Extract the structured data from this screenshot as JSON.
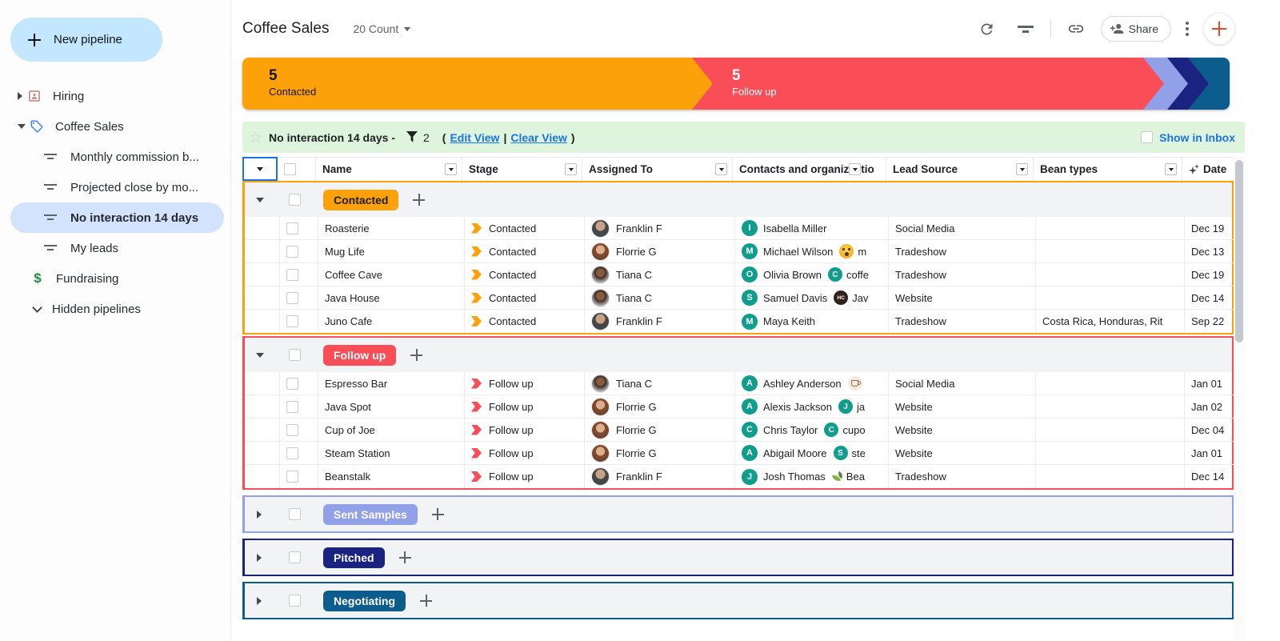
{
  "sidebar": {
    "new_pipeline_label": "New pipeline",
    "pipelines": [
      {
        "label": "Hiring"
      },
      {
        "label": "Coffee Sales"
      },
      {
        "label": "Fundraising"
      },
      {
        "label": "Hidden pipelines"
      }
    ],
    "views": [
      {
        "label": "Monthly commission b..."
      },
      {
        "label": "Projected close by mo..."
      },
      {
        "label": "No interaction 14 days"
      },
      {
        "label": "My leads"
      }
    ]
  },
  "header": {
    "title": "Coffee Sales",
    "count_label": "20 Count",
    "share_label": "Share"
  },
  "colors": {
    "contacted": "#FCA10A",
    "follow_up": "#F94D57",
    "sent_samples": "#92A0E8",
    "pitched": "#1A2480",
    "negotiating": "#0D5C8E",
    "link_blue": "#1A73E8",
    "filter_bar_green": "#DFF4DC",
    "contact_teal": "#0F9D8C",
    "accent_red_plus": "#E8442E"
  },
  "stagebar": {
    "stages": [
      {
        "name": "Contacted",
        "count": "5"
      },
      {
        "name": "Follow up",
        "count": "5"
      },
      {
        "name": "Sent Samples",
        "count": ""
      },
      {
        "name": "Pitched",
        "count": ""
      },
      {
        "name": "Negotiating",
        "count": ""
      }
    ]
  },
  "filterbar": {
    "view_name": "No interaction 14 days -",
    "filter_count": "2",
    "paren_open": "(",
    "edit_view": "Edit View",
    "pipe": "|",
    "clear_view": "Clear View",
    "paren_close": ")",
    "show_in_inbox": "Show in Inbox"
  },
  "table": {
    "columns": {
      "name": "Name",
      "stage": "Stage",
      "assigned": "Assigned To",
      "contacts_a": "Contacts and organiz",
      "contacts_b": "tio",
      "lead_source": "Lead Source",
      "bean_types": "Bean types",
      "date": "Date"
    },
    "groups": [
      {
        "label": "Contacted",
        "collapsed": false,
        "rows": [
          {
            "name": "Roasterie",
            "stage": "Contacted",
            "assigned": "Franklin F",
            "contact": "Isabella Miller",
            "contact_initial": "I",
            "org_text": "",
            "lead_source": "Social Media",
            "bean_types": "",
            "date": "Dec 19"
          },
          {
            "name": "Mug Life",
            "stage": "Contacted",
            "assigned": "Florrie G",
            "contact": "Michael Wilson",
            "contact_initial": "M",
            "org_text": "m",
            "lead_source": "Tradeshow",
            "bean_types": "",
            "date": "Dec 13"
          },
          {
            "name": "Coffee Cave",
            "stage": "Contacted",
            "assigned": "Tiana C",
            "contact": "Olivia Brown",
            "contact_initial": "O",
            "org_initial": "C",
            "org_text": "coffe",
            "lead_source": "Tradeshow",
            "bean_types": "",
            "date": "Dec 19"
          },
          {
            "name": "Java House",
            "stage": "Contacted",
            "assigned": "Tiana C",
            "contact": "Samuel Davis",
            "contact_initial": "S",
            "org_logo_text": "HC",
            "org_text": "Jav",
            "lead_source": "Website",
            "bean_types": "",
            "date": "Dec 14"
          },
          {
            "name": "Juno Cafe",
            "stage": "Contacted",
            "assigned": "Franklin F",
            "contact": "Maya Keith",
            "contact_initial": "M",
            "org_text": "",
            "lead_source": "Tradeshow",
            "bean_types": "Costa Rica, Honduras, Rit",
            "date": "Sep 22"
          }
        ]
      },
      {
        "label": "Follow up",
        "collapsed": false,
        "rows": [
          {
            "name": "Espresso Bar",
            "stage": "Follow up",
            "assigned": "Tiana C",
            "contact": "Ashley Anderson",
            "contact_initial": "A",
            "org_text": "",
            "lead_source": "Social Media",
            "bean_types": "",
            "date": "Jan 01"
          },
          {
            "name": "Java Spot",
            "stage": "Follow up",
            "assigned": "Florrie G",
            "contact": "Alexis Jackson",
            "contact_initial": "A",
            "org_initial": "J",
            "org_text": "ja",
            "lead_source": "Website",
            "bean_types": "",
            "date": "Jan 02"
          },
          {
            "name": "Cup of Joe",
            "stage": "Follow up",
            "assigned": "Florrie G",
            "contact": "Chris Taylor",
            "contact_initial": "C",
            "org_initial": "C",
            "org_text": "cupo",
            "lead_source": "Website",
            "bean_types": "",
            "date": "Dec 04"
          },
          {
            "name": "Steam Station",
            "stage": "Follow up",
            "assigned": "Florrie G",
            "contact": "Abigail Moore",
            "contact_initial": "A",
            "org_initial": "S",
            "org_text": "ste",
            "lead_source": "Website",
            "bean_types": "",
            "date": "Jan 01"
          },
          {
            "name": "Beanstalk",
            "stage": "Follow up",
            "assigned": "Franklin F",
            "contact": "Josh Thomas",
            "contact_initial": "J",
            "org_text": "Bea",
            "lead_source": "Tradeshow",
            "bean_types": "",
            "date": "Dec 14"
          }
        ]
      },
      {
        "label": "Sent Samples",
        "collapsed": true,
        "rows": []
      },
      {
        "label": "Pitched",
        "collapsed": true,
        "rows": []
      },
      {
        "label": "Negotiating",
        "collapsed": true,
        "rows": []
      }
    ]
  }
}
